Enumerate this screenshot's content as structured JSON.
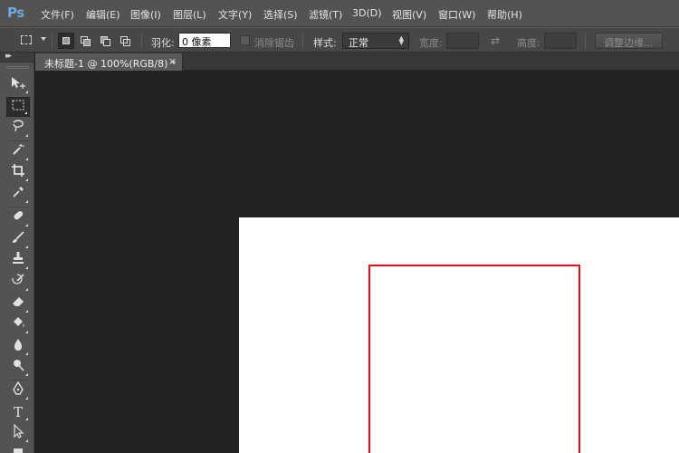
{
  "app": {
    "logo": "Ps",
    "menu": [
      "文件(F)",
      "编辑(E)",
      "图像(I)",
      "图层(L)",
      "文字(Y)",
      "选择(S)",
      "滤镜(T)",
      "3D(D)",
      "视图(V)",
      "窗口(W)",
      "帮助(H)"
    ]
  },
  "options": {
    "feather_label": "羽化:",
    "feather_value": "0 像素",
    "antialias_label": "消除锯齿",
    "style_label": "样式:",
    "style_value": "正常",
    "width_label": "宽度:",
    "height_label": "高度:",
    "refine_edge_label": "调整边缘..."
  },
  "document": {
    "tab_title": "未标题-1 @ 100%(RGB/8) *",
    "close_glyph": "×"
  },
  "icons": {
    "collapse": "double-chevron-right-icon",
    "swap": "swap-arrows-icon"
  },
  "colors": {
    "selection_stroke": "#e3101e",
    "canvas": "#ffffff",
    "workspace": "#222222",
    "logo": "#6fa8dc"
  }
}
